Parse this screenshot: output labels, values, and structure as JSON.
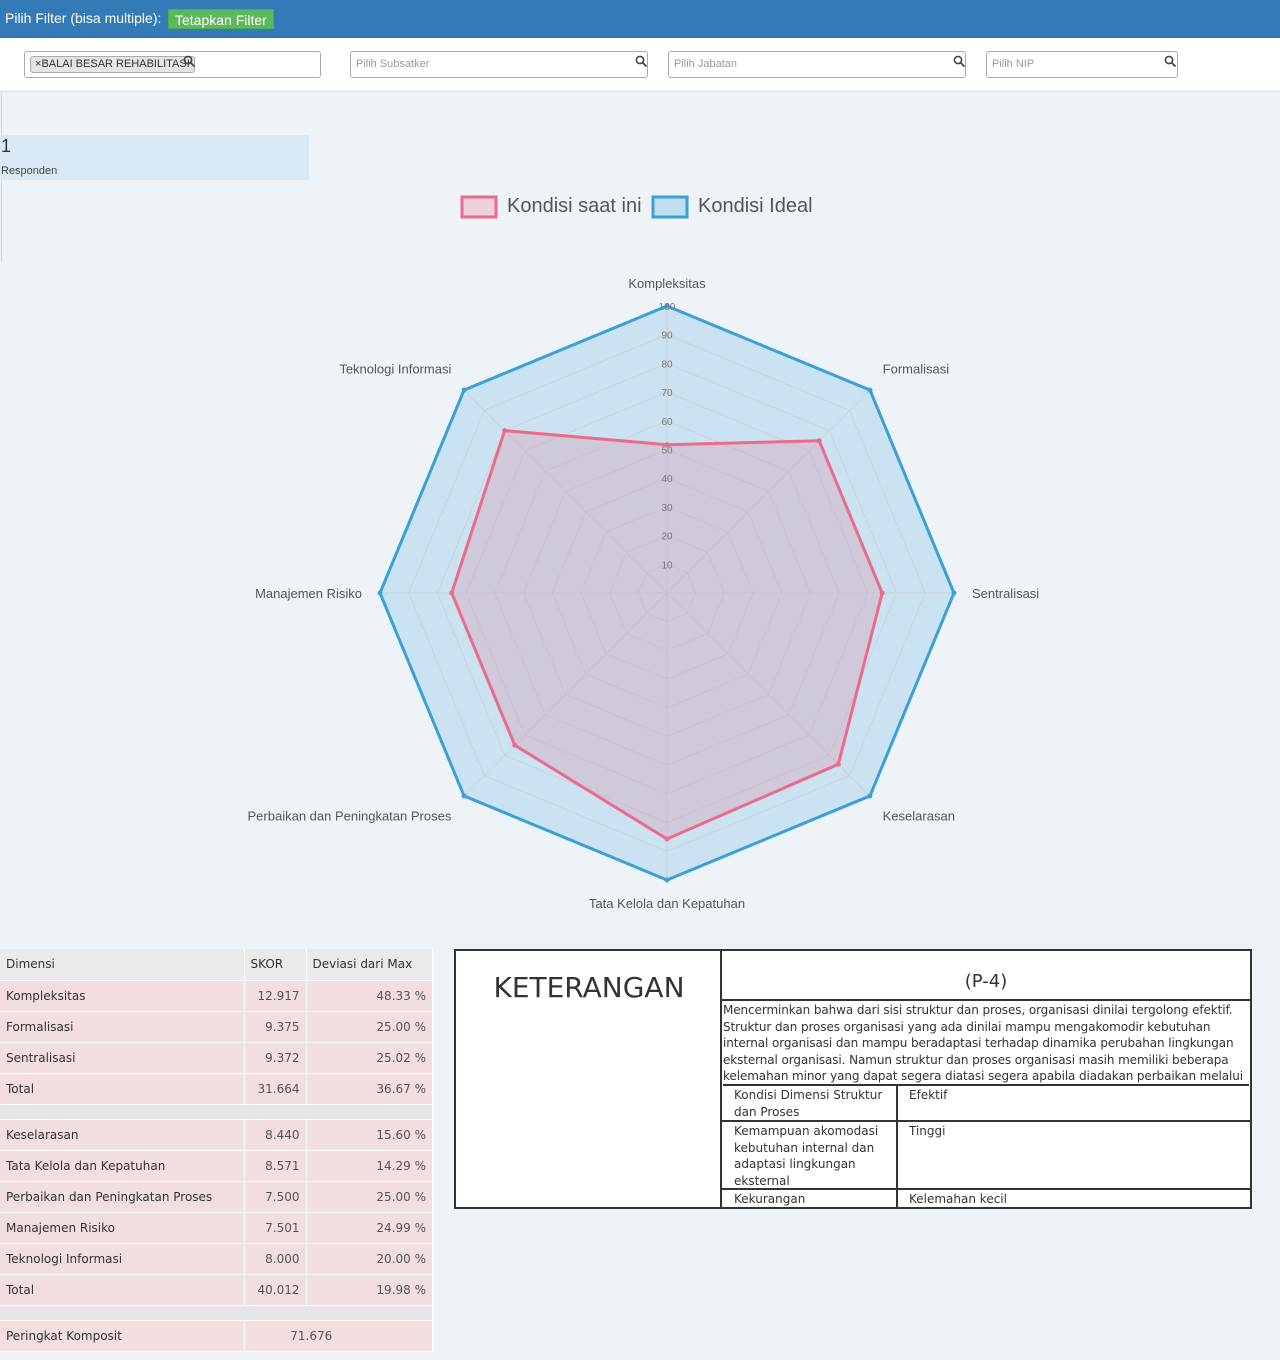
{
  "topbar": {
    "label": "Pilih Filter (bisa multiple):",
    "apply_button": "Tetapkan Filter"
  },
  "filters": {
    "unit": {
      "selected_chip": "BALAI BESAR REHABILITASI"
    },
    "subsatker": {
      "placeholder": "Pilih Subsatker"
    },
    "jabatan": {
      "placeholder": "Pilih Jabatan"
    },
    "nip": {
      "placeholder": "Pilih NIP"
    }
  },
  "respondents": {
    "count": "1",
    "label": "Responden"
  },
  "chart_data": {
    "type": "radar",
    "labels": [
      "Kompleksitas",
      "Formalisasi",
      "Sentralisasi",
      "Keselarasan",
      "Tata Kelola dan Kepatuhan",
      "Perbaikan dan Peningkatan Proses",
      "Manajemen Risiko",
      "Teknologi Informasi"
    ],
    "ticks": [
      10,
      20,
      30,
      40,
      50,
      60,
      70,
      80,
      90,
      100
    ],
    "rlim": [
      0,
      100
    ],
    "legend_position": "top",
    "series": [
      {
        "name": "Kondisi saat ini",
        "values": [
          51.67,
          75,
          74.98,
          84.4,
          85.71,
          75,
          75.01,
          80
        ],
        "color": "#ec6a8a"
      },
      {
        "name": "Kondisi Ideal",
        "values": [
          100,
          100,
          100,
          100,
          100,
          100,
          100,
          100
        ],
        "color": "#3aa0d8"
      }
    ]
  },
  "score_table": {
    "headers": [
      "Dimensi",
      "SKOR",
      "Deviasi dari Max"
    ],
    "group1": [
      [
        "Kompleksitas",
        "12.917",
        "48.33 %"
      ],
      [
        "Formalisasi",
        "9.375",
        "25.00 %"
      ],
      [
        "Sentralisasi",
        "9.372",
        "25.02 %"
      ],
      [
        "Total",
        "31.664",
        "36.67 %"
      ]
    ],
    "group2": [
      [
        "Keselarasan",
        "8.440",
        "15.60 %"
      ],
      [
        "Tata Kelola dan Kepatuhan",
        "8.571",
        "14.29 %"
      ],
      [
        "Perbaikan dan Peningkatan Proses",
        "7.500",
        "25.00 %"
      ],
      [
        "Manajemen Risiko",
        "7.501",
        "24.99 %"
      ],
      [
        "Teknologi Informasi",
        "8.000",
        "20.00 %"
      ],
      [
        "Total",
        "40.012",
        "19.98 %"
      ]
    ],
    "composite": {
      "label": "Peringkat Komposit",
      "value": "71.676"
    }
  },
  "keterangan": {
    "title": "KETERANGAN",
    "code": "(P-4)",
    "description": "Mencerminkan bahwa dari sisi struktur dan proses, organisasi dinilai tergolong efektif. Struktur dan proses organisasi yang ada dinilai mampu mengakomodir kebutuhan internal organisasi dan mampu beradaptasi terhadap dinamika perubahan lingkungan eksternal organisasi. Namun struktur dan proses organisasi masih memiliki beberapa kelemahan minor yang dapat segera diatasi segera apabila diadakan perbaikan melalui tindakan rutin yang bersifat marjinal.",
    "rows": [
      {
        "key": "Kondisi Dimensi Struktur dan Proses",
        "value": "Efektif"
      },
      {
        "key": "Kemampuan akomodasi kebutuhan internal dan adaptasi lingkungan eksternal",
        "value": "Tinggi"
      },
      {
        "key": "Kekurangan",
        "value": "Kelemahan kecil"
      }
    ]
  }
}
